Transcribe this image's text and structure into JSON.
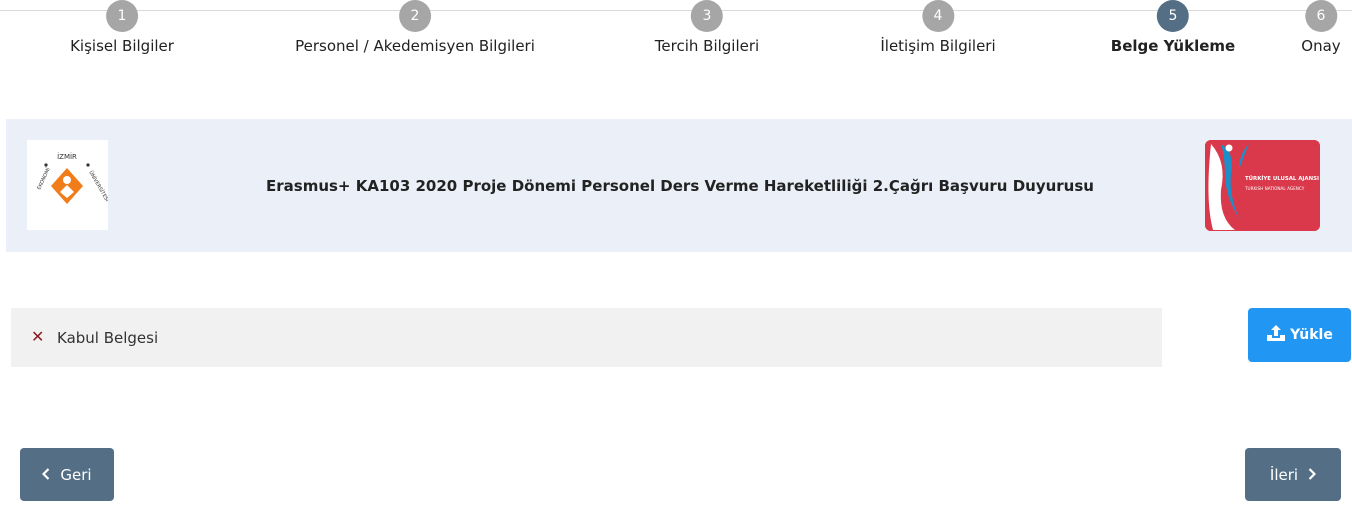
{
  "stepper": {
    "steps": [
      {
        "number": "1",
        "label": "Kişisel Bilgiler"
      },
      {
        "number": "2",
        "label": "Personel / Akedemisyen Bilgileri"
      },
      {
        "number": "3",
        "label": "Tercih Bilgileri"
      },
      {
        "number": "4",
        "label": "İletişim Bilgileri"
      },
      {
        "number": "5",
        "label": "Belge Yükleme"
      },
      {
        "number": "6",
        "label": "Onay"
      }
    ],
    "active_step": 5
  },
  "banner": {
    "title": "Erasmus+ KA103 2020 Proje Dönemi Personel Ders Verme Hareketliliği 2.Çağrı Başvuru Duyurusu",
    "left_logo_text_top": "İZMİR",
    "left_logo_text_left": "EKONOMİ",
    "left_logo_text_right": "ÜNİVERSİTESİ",
    "right_logo_text_1": "TÜRKİYE ULUSAL AJANSI",
    "right_logo_text_2": "TURKISH NATIONAL AGENCY"
  },
  "documents": [
    {
      "status_icon": "x-icon",
      "label": "Kabul Belgesi"
    }
  ],
  "upload": {
    "label": "Yükle"
  },
  "nav": {
    "back_label": "Geri",
    "next_label": "İleri"
  },
  "colors": {
    "step_inactive": "#a6a6a6",
    "step_active": "#546e85",
    "banner_bg": "#ebf0f8",
    "upload_btn": "#2196f3",
    "nav_btn": "#546e85",
    "status_x": "#8b1c1c"
  }
}
